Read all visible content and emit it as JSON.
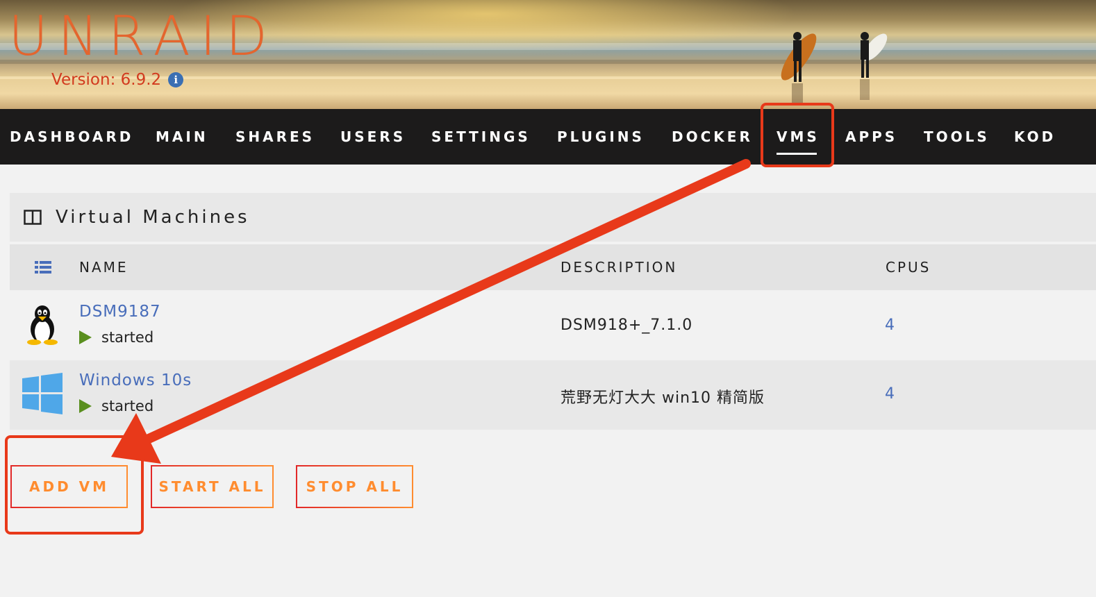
{
  "header": {
    "logo_text": "UNRAID",
    "version_label": "Version: 6.9.2",
    "info_icon": "info-icon"
  },
  "nav": {
    "items": [
      {
        "label": "DASHBOARD"
      },
      {
        "label": "MAIN"
      },
      {
        "label": "SHARES"
      },
      {
        "label": "USERS"
      },
      {
        "label": "SETTINGS"
      },
      {
        "label": "PLUGINS"
      },
      {
        "label": "DOCKER"
      },
      {
        "label": "VMS",
        "active": true
      },
      {
        "label": "APPS"
      },
      {
        "label": "TOOLS"
      },
      {
        "label": "KOD"
      }
    ]
  },
  "panel": {
    "title": "Virtual Machines",
    "icon": "columns-icon"
  },
  "table": {
    "list_icon": "list-icon",
    "headers": {
      "name": "NAME",
      "description": "DESCRIPTION",
      "cpus": "CPUS"
    },
    "rows": [
      {
        "icon": "linux-tux-icon",
        "name": "DSM9187",
        "status": "started",
        "description": "DSM918+_7.1.0",
        "cpus": "4"
      },
      {
        "icon": "windows-icon",
        "name": "Windows 10s",
        "status": "started",
        "description": "荒野无灯大大 win10 精简版",
        "cpus": "4"
      }
    ]
  },
  "buttons": {
    "add_vm": "ADD VM",
    "start_all": "START ALL",
    "stop_all": "STOP ALL"
  },
  "colors": {
    "accent_orange": "#ff8c2f",
    "accent_red": "#e22828",
    "annotation_red": "#e8391a",
    "link_blue": "#486dba",
    "nav_bg": "#1c1b1b"
  }
}
